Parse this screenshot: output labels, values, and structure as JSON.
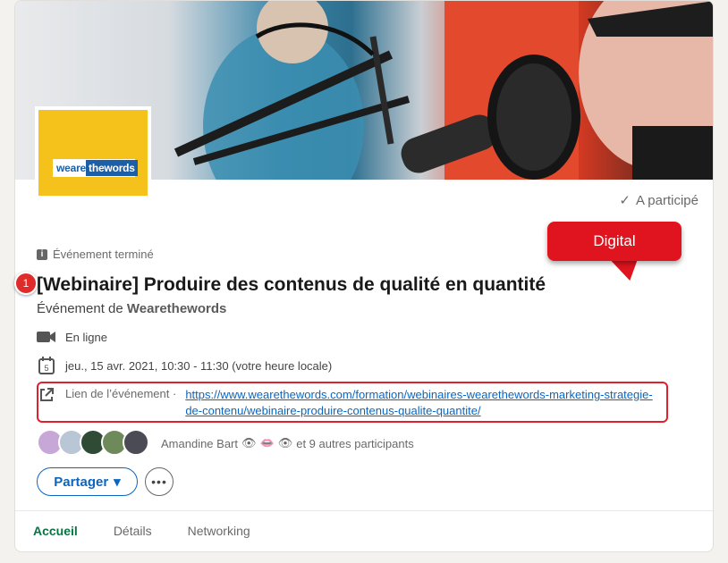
{
  "event": {
    "participated_label": "A participé",
    "status_label": "Événement terminé",
    "title": "[Webinaire] Produire des contenus de qualité en quantité",
    "organizer_prefix": "Événement de",
    "organizer": "Wearethewords",
    "location": "En ligne",
    "datetime": "jeu., 15 avr. 2021, 10:30 - 11:30 (votre heure locale)",
    "link_label": "Lien de l’événement ·",
    "link_url": "https://www.wearethewords.com/formation/webinaires-wearethewords-marketing-strategie-de-contenu/webinaire-produire-contenus-qualite-quantite/",
    "attendee_name": "Amandine Bart",
    "attendee_rest": "et 9 autres participants",
    "share_label": "Partager",
    "more_label": "•••"
  },
  "logo": {
    "text_plain": "weare",
    "text_accent": "thewords"
  },
  "calendar_day": "5",
  "tabs": [
    {
      "label": "Accueil",
      "active": true
    },
    {
      "label": "Détails",
      "active": false
    },
    {
      "label": "Networking",
      "active": false
    }
  ],
  "annotations": {
    "badge_number": "1",
    "callout_text": "Digital"
  },
  "avatars": [
    {
      "color": "#c7a6d8"
    },
    {
      "color": "#b8c6d6"
    },
    {
      "color": "#2f4a35"
    },
    {
      "color": "#6f8a5a"
    },
    {
      "color": "#4b4b55"
    }
  ],
  "colors": {
    "accent": "#0a66c2",
    "active_tab": "#057642",
    "annotation_red": "#e0141e",
    "logo_yellow": "#f4c21a"
  }
}
